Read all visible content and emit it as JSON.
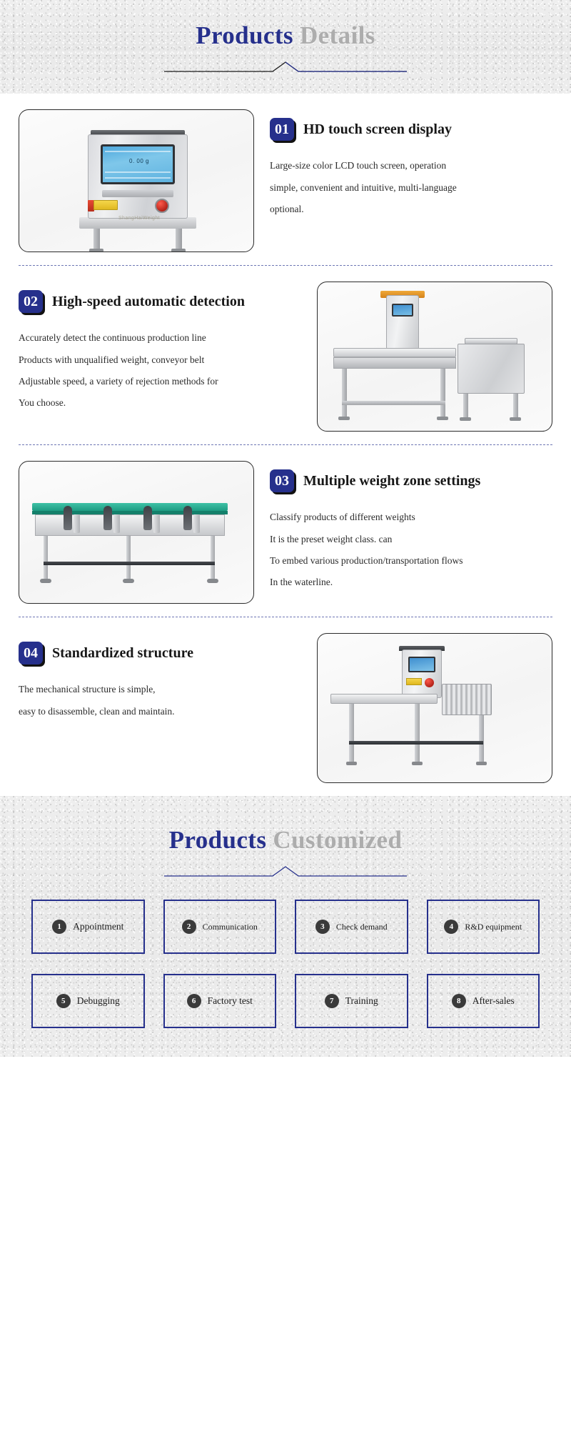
{
  "colors": {
    "brand_blue": "#26308c",
    "muted_gray": "#adadad",
    "badge_shadow": "#121212",
    "text_dark": "#1d1d1d",
    "divider": "#5560a8"
  },
  "details_banner": {
    "title_primary": "Products",
    "title_secondary": "Details",
    "rule_icon": "peak-divider-icon"
  },
  "features": [
    {
      "number": "01",
      "title": "HD touch screen display",
      "lines": [
        "Large-size color LCD touch screen, operation",
        "simple, convenient and intuitive, multi-language",
        "optional."
      ],
      "image_name": "checkweigher-control-cabinet-photo",
      "screen_value": "0. 00 g",
      "layout": "image-left"
    },
    {
      "number": "02",
      "title": "High-speed automatic detection",
      "lines": [
        "Accurately detect the continuous production line",
        "Products with unqualified weight, conveyor belt",
        "Adjustable speed, a variety of rejection methods for",
        "You choose."
      ],
      "image_name": "checkweigher-with-reject-bin-photo",
      "layout": "image-right"
    },
    {
      "number": "03",
      "title": "Multiple weight zone settings",
      "lines": [
        "Classify products of different weights",
        "It is the preset weight class. can",
        "To embed various production/transportation flows",
        "In the waterline."
      ],
      "image_name": "multi-zone-sorting-conveyor-photo",
      "layout": "image-left"
    },
    {
      "number": "04",
      "title": "Standardized structure",
      "lines": [
        "The mechanical structure is simple,",
        "easy to disassemble, clean and maintain."
      ],
      "image_name": "standardized-checkweigher-photo",
      "layout": "image-right"
    }
  ],
  "customized_banner": {
    "title_primary": "Products",
    "title_secondary": "Customized",
    "rule_icon": "peak-divider-icon"
  },
  "steps": [
    {
      "number": "1",
      "label": "Appointment"
    },
    {
      "number": "2",
      "label": "Communication"
    },
    {
      "number": "3",
      "label": "Check demand"
    },
    {
      "number": "4",
      "label": "R&D equipment"
    },
    {
      "number": "5",
      "label": "Debugging"
    },
    {
      "number": "6",
      "label": "Factory test"
    },
    {
      "number": "7",
      "label": "Training"
    },
    {
      "number": "8",
      "label": "After-sales"
    }
  ]
}
